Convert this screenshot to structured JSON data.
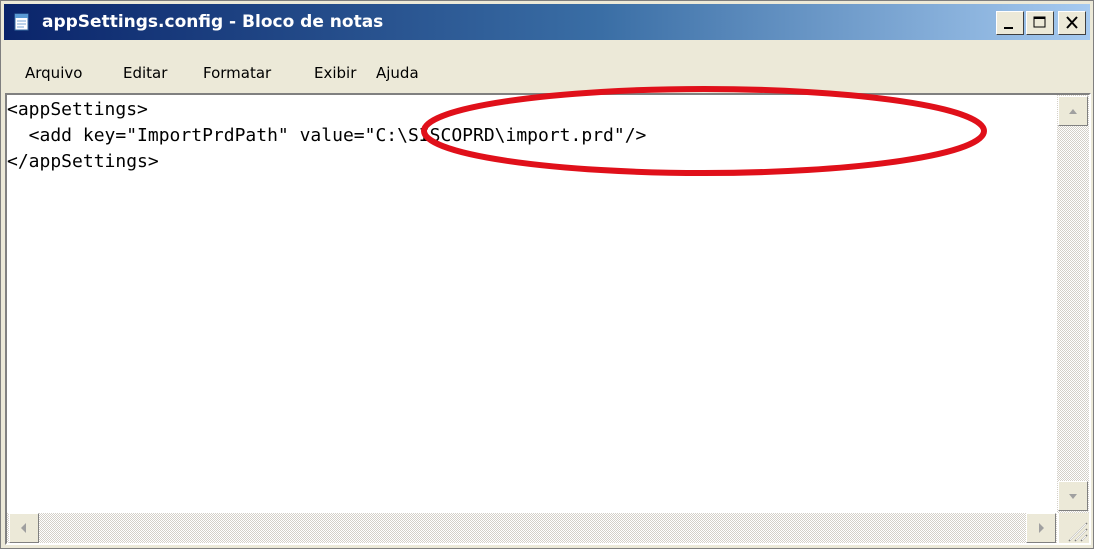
{
  "window": {
    "title": "appSettings.config - Bloco de notas"
  },
  "menu": {
    "items": [
      {
        "label": "Arquivo"
      },
      {
        "label": "Editar"
      },
      {
        "label": "Formatar"
      },
      {
        "label": "Exibir"
      },
      {
        "label": "Ajuda"
      }
    ]
  },
  "editor": {
    "lines": [
      "<appSettings>",
      "  <add key=\"ImportPrdPath\" value=\"C:\\SISCOPRD\\import.prd\"/>",
      "</appSettings>"
    ]
  },
  "annotation": {
    "color": "#e0101a"
  },
  "icons": {
    "app": "notepad-icon",
    "minimize": "minimize-icon",
    "maximize": "maximize-icon",
    "close": "close-icon"
  }
}
